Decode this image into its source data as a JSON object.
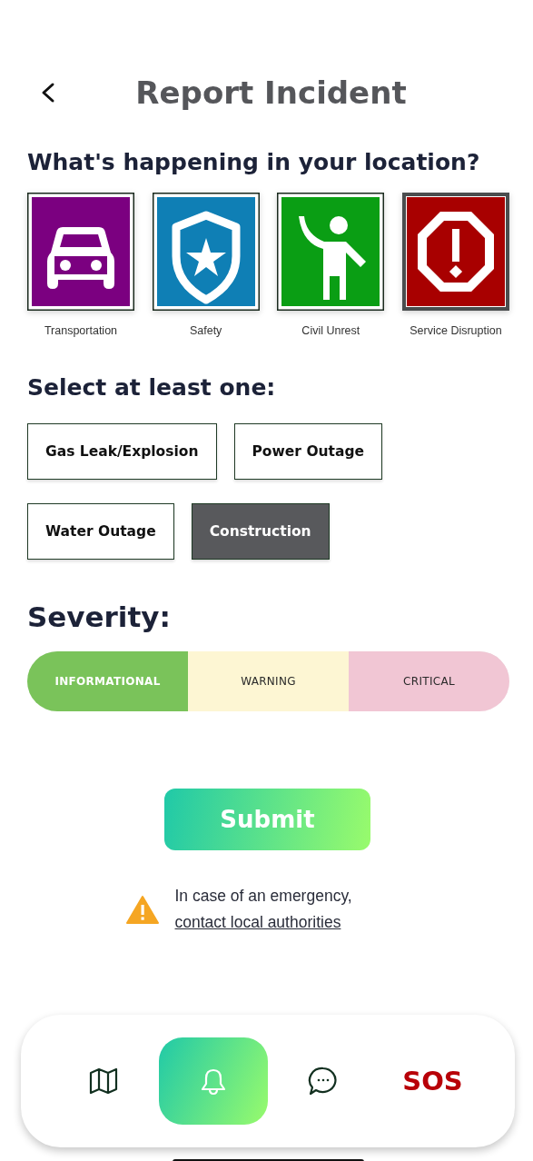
{
  "header": {
    "title": "Report Incident"
  },
  "categories_section": {
    "heading": "What's happening in your location?",
    "items": [
      {
        "kind": "car",
        "label": "Transportation",
        "color": "#7b0080",
        "selected": false
      },
      {
        "kind": "shield",
        "label": "Safety",
        "color": "#0f7fb5",
        "selected": false
      },
      {
        "kind": "person",
        "label": "Civil Unrest",
        "color": "#0a9e14",
        "selected": false
      },
      {
        "kind": "alert",
        "label": "Service Disruption",
        "color": "#a80000",
        "selected": true
      }
    ]
  },
  "subtypes_section": {
    "heading": "Select at least one:",
    "items": [
      {
        "label": "Gas Leak/Explosion",
        "selected": false
      },
      {
        "label": "Power Outage",
        "selected": false
      },
      {
        "label": "Water Outage",
        "selected": false
      },
      {
        "label": "Construction",
        "selected": true
      }
    ]
  },
  "severity_section": {
    "heading": "Severity:",
    "items": [
      {
        "label": "INFORMATIONAL",
        "color": "#7ac35a",
        "selected": true
      },
      {
        "label": "WARNING",
        "color": "#fdf6d3",
        "selected": false
      },
      {
        "label": "CRITICAL",
        "color": "#f1c6d4",
        "selected": false
      }
    ]
  },
  "submit_button": {
    "label": "Submit"
  },
  "notice": {
    "text": "In case of an emergency,",
    "link": "contact local authorities"
  },
  "bottom_nav": {
    "items": [
      {
        "kind": "map",
        "selected": false
      },
      {
        "kind": "bell",
        "selected": true
      },
      {
        "kind": "chat",
        "selected": false
      },
      {
        "kind": "text",
        "label": "SOS",
        "selected": false
      }
    ]
  }
}
